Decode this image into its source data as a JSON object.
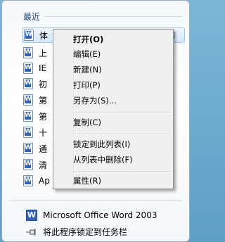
{
  "jumplist": {
    "section_title": "最近",
    "items": [
      {
        "label": "体"
      },
      {
        "label": "上"
      },
      {
        "label": "IE"
      },
      {
        "label": "初"
      },
      {
        "label": "第"
      },
      {
        "label": "第"
      },
      {
        "label": "十"
      },
      {
        "label": "通"
      },
      {
        "label": "清"
      },
      {
        "label": "Ap"
      }
    ],
    "app_name": "Microsoft Office Word 2003",
    "pin_taskbar_label": "将此程序锁定到任务栏"
  },
  "context_menu": {
    "items": [
      {
        "label": "打开(O)"
      },
      {
        "label": "编辑(E)"
      },
      {
        "label": "新建(N)"
      },
      {
        "label": "打印(P)"
      },
      {
        "label": "另存为(S)..."
      },
      {
        "label": "复制(C)"
      },
      {
        "label": "锁定到此列表(I)"
      },
      {
        "label": "从列表中删除(F)"
      },
      {
        "label": "属性(R)"
      }
    ]
  }
}
